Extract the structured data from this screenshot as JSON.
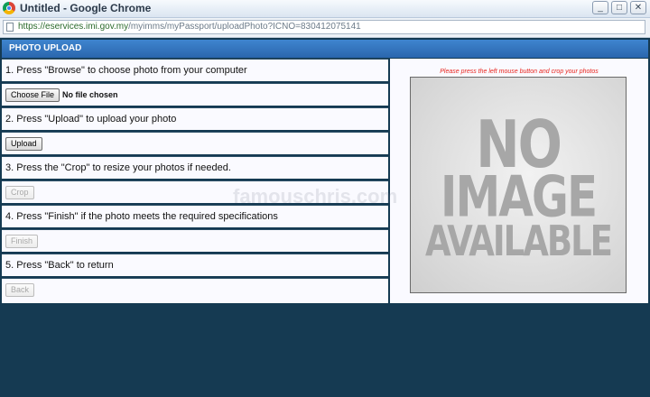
{
  "window": {
    "title": "Untitled - Google Chrome",
    "controls": [
      "_",
      "□",
      "✕"
    ]
  },
  "address_bar": {
    "url_host": "https://eservices.imi.gov.my",
    "url_path": "/myimms/myPassport/uploadPhoto?ICNO=830412075141"
  },
  "panel": {
    "header": "PHOTO UPLOAD",
    "steps": [
      {
        "text": "1. Press \"Browse\" to choose photo from your computer"
      },
      {
        "text": "2. Press \"Upload\" to upload your photo"
      },
      {
        "text": "3. Press the \"Crop\" to resize your photos if needed."
      },
      {
        "text": "4. Press \"Finish\" if the photo meets the required specifications"
      },
      {
        "text": "5. Press \"Back\" to return"
      }
    ],
    "file_input": {
      "button_label": "Choose File",
      "status": "No file chosen"
    },
    "buttons": {
      "upload": "Upload",
      "crop": "Crop",
      "finish": "Finish",
      "back": "Back"
    }
  },
  "preview": {
    "instruction": "Please press the left mouse button and crop your photos",
    "placeholder_lines": [
      "NO",
      "IMAGE",
      "AVAILABLE"
    ]
  },
  "watermark": "famouschris.com",
  "colors": {
    "background": "#153a52",
    "header": "#2a66ad",
    "instruction": "#e8251e"
  }
}
